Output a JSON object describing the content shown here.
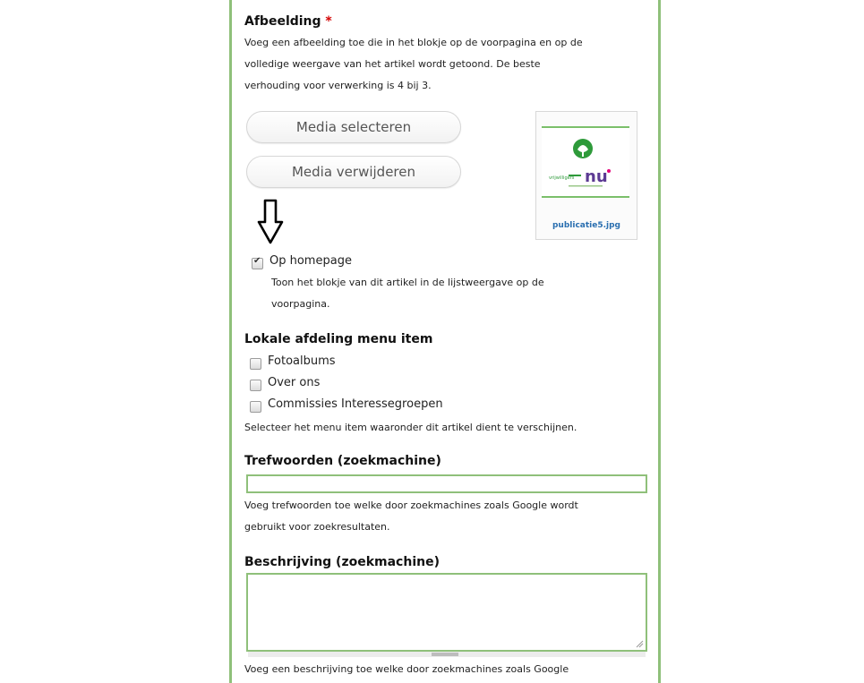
{
  "afbeelding": {
    "label": "Afbeelding",
    "required_mark": "*",
    "description_lines": [
      "Voeg een afbeelding toe die in het blokje op de voorpagina en op de",
      "volledige weergave van het artikel wordt getoond. De beste",
      "verhouding voor verwerking is 4 bij 3."
    ],
    "select_button": "Media selecteren",
    "remove_button": "Media verwijderen",
    "preview_filename": "publicatie5.jpg",
    "logo_text": "nu",
    "logo_small_text": "vrijwilligers"
  },
  "homepage": {
    "label": "Op homepage",
    "checked": true,
    "description_lines": [
      "Toon het blokje van dit artikel in de lijstweergave op de",
      "voorpagina."
    ]
  },
  "menu": {
    "label": "Lokale afdeling menu item",
    "items": [
      "Fotoalbums",
      "Over ons",
      "Commissies Interessegroepen"
    ],
    "help": "Selecteer het menu item waaronder dit artikel dient te verschijnen."
  },
  "trefwoorden": {
    "label": "Trefwoorden (zoekmachine)",
    "value": "",
    "help_lines": [
      "Voeg trefwoorden toe welke door zoekmachines zoals Google wordt",
      "gebruikt voor zoekresultaten."
    ]
  },
  "beschrijving": {
    "label": "Beschrijving (zoekmachine)",
    "value": "",
    "help": "Voeg een beschrijving toe welke door zoekmachines zoals Google"
  },
  "colors": {
    "panel_border": "#8fc07a",
    "required": "#d40000",
    "link": "#2a6fb0"
  }
}
